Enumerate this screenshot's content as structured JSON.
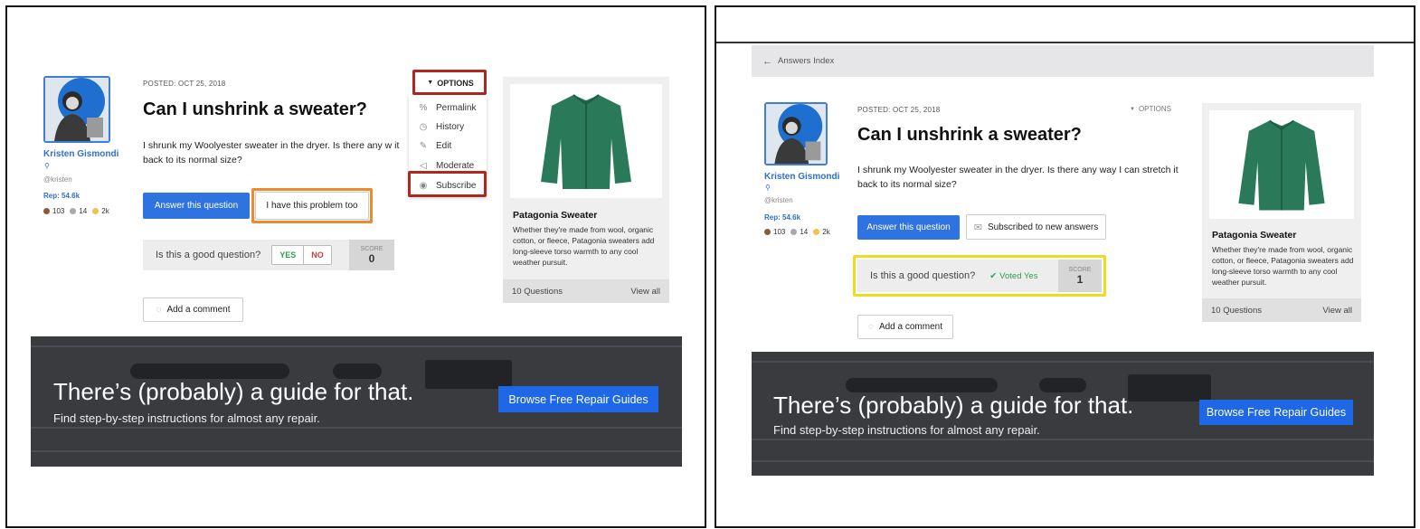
{
  "left": {
    "author": {
      "name": "Kristen Gismondi",
      "handle": "@kristen",
      "rep": "Rep: 54.6k",
      "badge_bronze": "103",
      "badge_silver": "14",
      "badge_gold": "2k"
    },
    "question": {
      "posted": "POSTED: OCT 25, 2018",
      "title": "Can I unshrink a sweater?",
      "body": "I shrunk my Woolyester sweater in the dryer. Is there any w it back to its normal size?"
    },
    "answer_button": "Answer this question",
    "problem_button": "I have this problem too",
    "vote": {
      "label": "Is this a good question?",
      "yes": "YES",
      "no": "NO",
      "score_label": "SCORE",
      "score": "0"
    },
    "comment_button": "Add a comment",
    "options_label": "OPTIONS",
    "menu": {
      "permalink": "Permalink",
      "history": "History",
      "edit": "Edit",
      "moderate": "Moderate",
      "subscribe": "Subscribe"
    },
    "card": {
      "title": "Patagonia Sweater",
      "description": "Whether they're made from wool, organic cotton, or fleece, Patagonia sweaters add long-sleeve torso warmth to any cool weather pursuit.",
      "questions": "10 Questions",
      "view_all": "View all"
    },
    "banner": {
      "title": "There’s (probably) a guide for that.",
      "subtitle": "Find step-by-step instructions for almost any repair.",
      "button": "Browse Free Repair Guides"
    }
  },
  "right": {
    "breadcrumb": "Answers Index",
    "author": {
      "name": "Kristen Gismondi",
      "handle": "@kristen",
      "rep": "Rep: 54.6k",
      "badge_bronze": "103",
      "badge_silver": "14",
      "badge_gold": "2k"
    },
    "question": {
      "posted": "POSTED: OCT 25, 2018",
      "title": "Can I unshrink a sweater?",
      "body": "I shrunk my Woolyester sweater in the dryer. Is there any way I can stretch it back to its normal size?"
    },
    "options_label": "OPTIONS",
    "answer_button": "Answer this question",
    "subscribed_button": "Subscribed to new answers",
    "vote": {
      "label": "Is this a good question?",
      "voted": "Voted Yes",
      "score_label": "SCORE",
      "score": "1"
    },
    "comment_button": "Add a comment",
    "card": {
      "title": "Patagonia Sweater",
      "description": "Whether they're made from wool, organic cotton, or fleece, Patagonia sweaters add long-sleeve torso warmth to any cool weather pursuit.",
      "questions": "10 Questions",
      "view_all": "View all"
    },
    "banner": {
      "title": "There’s (probably) a guide for that.",
      "subtitle": "Find step-by-step instructions for almost any repair.",
      "button": "Browse Free Repair Guides"
    }
  },
  "colors": {
    "primary": "#2f73e0",
    "highlight_red": "#b3261e",
    "highlight_orange": "#ee8a2d",
    "highlight_yellow": "#f0dc1e",
    "vote_yes": "#2e9e4f",
    "vote_no": "#d23b3b",
    "banner_button": "#1e67e6"
  },
  "icons": {
    "permalink": "link-icon",
    "history": "clock-icon",
    "edit": "pencil-icon",
    "moderate": "megaphone-icon",
    "subscribe": "eye-icon",
    "comment": "speech-bubble-icon",
    "subscribed": "envelope-icon",
    "voted": "checkmark-icon",
    "breadcrumb": "arrow-left-icon"
  }
}
